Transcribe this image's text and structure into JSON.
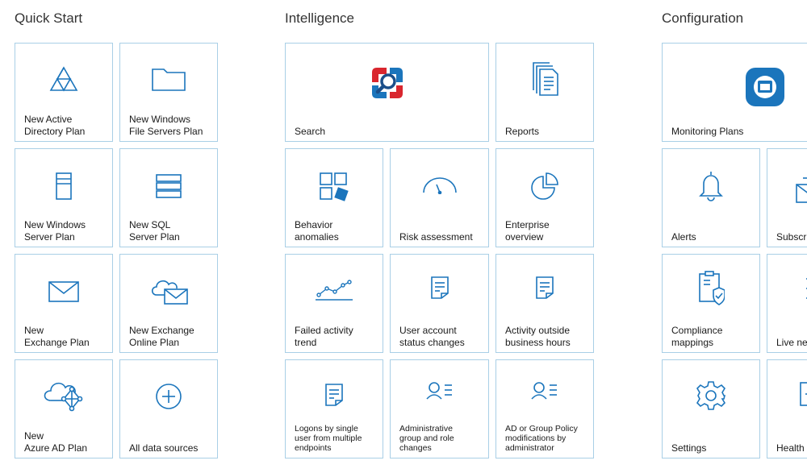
{
  "sections": {
    "quick_start": "Quick Start",
    "intelligence": "Intelligence",
    "configuration": "Configuration"
  },
  "quick_start": [
    {
      "label": "New Active\nDirectory Plan",
      "icon": "active-directory-icon"
    },
    {
      "label": "New Windows\nFile Servers Plan",
      "icon": "folder-icon"
    },
    {
      "label": "New Windows\nServer Plan",
      "icon": "server-tower-icon"
    },
    {
      "label": "New SQL\nServer Plan",
      "icon": "database-stack-icon"
    },
    {
      "label": "New\nExchange Plan",
      "icon": "envelope-icon"
    },
    {
      "label": "New Exchange\nOnline Plan",
      "icon": "cloud-envelope-icon"
    },
    {
      "label": "New\nAzure AD Plan",
      "icon": "cloud-network-icon"
    },
    {
      "label": "All data sources",
      "icon": "plus-circle-icon"
    }
  ],
  "intelligence": {
    "search": {
      "label": "Search",
      "icon": "search-logo-icon"
    },
    "reports": {
      "label": "Reports",
      "icon": "documents-icon"
    },
    "tiles": [
      {
        "label": "Behavior\nanomalies",
        "icon": "anomaly-grid-icon"
      },
      {
        "label": "Risk assessment",
        "icon": "gauge-icon"
      },
      {
        "label": "Enterprise\noverview",
        "icon": "pie-chart-icon"
      },
      {
        "label": "Failed activity\ntrend",
        "icon": "trend-line-icon"
      },
      {
        "label": "User account\nstatus changes",
        "icon": "document-icon"
      },
      {
        "label": "Activity outside\nbusiness hours",
        "icon": "document-icon"
      },
      {
        "label": "Logons by single\nuser from multiple\nendpoints",
        "icon": "document-icon"
      },
      {
        "label": "Administrative\ngroup and role\nchanges",
        "icon": "user-list-icon"
      },
      {
        "label": "AD or Group Policy\nmodifications by\nadministrator",
        "icon": "user-list-icon"
      }
    ]
  },
  "configuration": {
    "monitoring": {
      "label": "Monitoring Plans",
      "icon": "monitoring-app-icon"
    },
    "tiles": [
      {
        "label": "Alerts",
        "icon": "bell-icon"
      },
      {
        "label": "Subscr",
        "icon": "subscription-icon"
      },
      {
        "label": "Compliance\nmappings",
        "icon": "compliance-shield-icon"
      },
      {
        "label": "Live ne",
        "icon": "live-news-icon"
      },
      {
        "label": "Settings",
        "icon": "gear-icon"
      },
      {
        "label": "Health",
        "icon": "health-icon"
      }
    ]
  },
  "colors": {
    "accent": "#1b75bc",
    "tile_border": "#a9cfe6",
    "search_red": "#d9262e"
  }
}
